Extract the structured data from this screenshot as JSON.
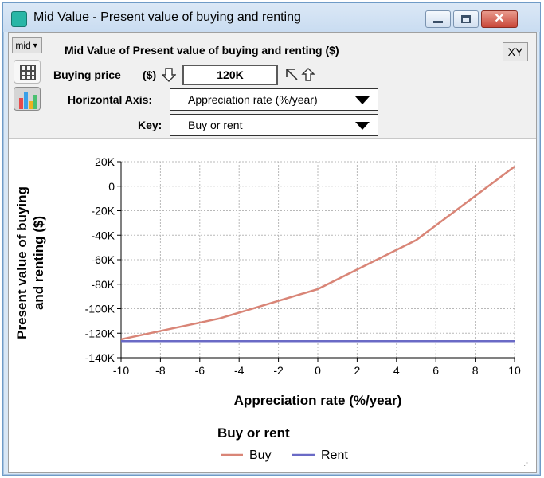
{
  "window": {
    "title": "Mid Value - Present value of buying and renting",
    "close_glyph": "✕"
  },
  "toolbar": {
    "mode_label": "mid",
    "result_title": "Mid Value of Present value of buying and renting ($)",
    "xy_label": "XY",
    "input": {
      "label": "Buying price",
      "unit": "($)",
      "value": "120K"
    },
    "horizontal_axis": {
      "label": "Horizontal Axis:",
      "value": "Appreciation rate (%/year)"
    },
    "key": {
      "label": "Key:",
      "value": "Buy or rent"
    }
  },
  "icons": {
    "table": "table-icon",
    "graph": "graph-icon",
    "input_arrow": "down-arrow-icon"
  },
  "chart_data": {
    "type": "line",
    "title": "",
    "xlabel": "Appreciation rate (%/year)",
    "ylabel": "Present value of buying and renting ($)",
    "ylabel_lines": [
      "Present value of buying",
      "and renting ($)"
    ],
    "xlim": [
      -10,
      10
    ],
    "ylim": [
      -140000,
      20000
    ],
    "x_ticks": [
      -10,
      -8,
      -6,
      -4,
      -2,
      0,
      2,
      4,
      6,
      8,
      10
    ],
    "y_ticks": [
      20000,
      0,
      -20000,
      -40000,
      -60000,
      -80000,
      -100000,
      -120000,
      -140000
    ],
    "y_tick_labels": [
      "20K",
      "0",
      "-20K",
      "-40K",
      "-60K",
      "-80K",
      "-100K",
      "-120K",
      "-140K"
    ],
    "grid": true,
    "legend": {
      "title": "Buy or rent",
      "position": "bottom"
    },
    "series": [
      {
        "name": "Buy",
        "color": "#d98577",
        "x": [
          -10,
          -5,
          0,
          5,
          10
        ],
        "y": [
          -125000,
          -108000,
          -84000,
          -44000,
          16000
        ]
      },
      {
        "name": "Rent",
        "color": "#6a6ac6",
        "x": [
          -10,
          10
        ],
        "y": [
          -126500,
          -126500
        ]
      }
    ]
  }
}
